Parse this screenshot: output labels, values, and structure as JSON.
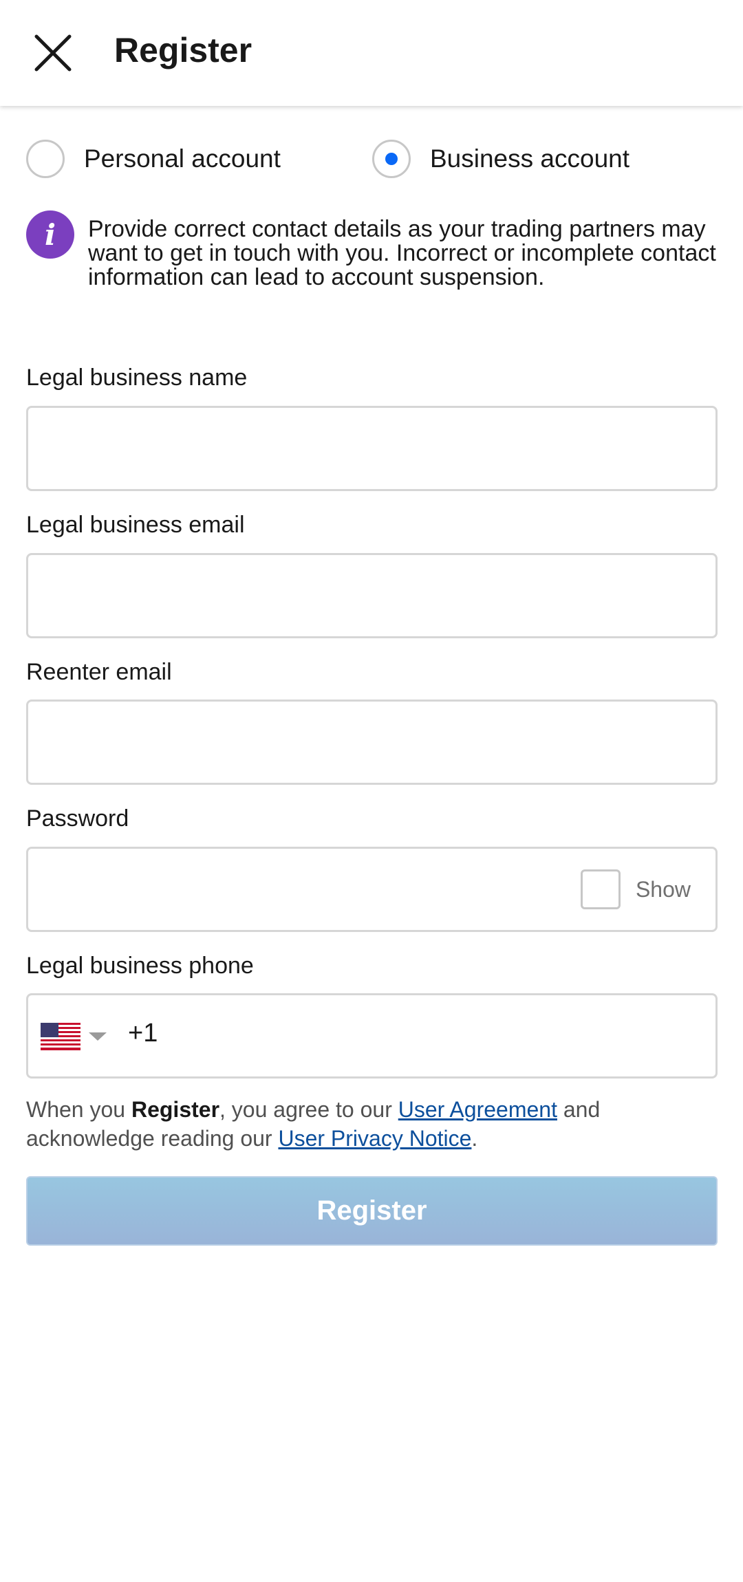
{
  "header": {
    "title": "Register",
    "close_icon": "close-icon"
  },
  "account_type": {
    "options": [
      {
        "label": "Personal account",
        "selected": false
      },
      {
        "label": "Business account",
        "selected": true
      }
    ],
    "selected_color": "#0968f6"
  },
  "notice": {
    "icon": "info-icon",
    "icon_letter": "i",
    "icon_color": "#7b3fbf",
    "text": "Provide correct contact details as your trading partners may want to get in touch with you. Incorrect or incomplete contact information can lead to account suspension."
  },
  "form": {
    "business_name": {
      "label": "Legal business name",
      "value": ""
    },
    "business_email": {
      "label": "Legal business email",
      "value": ""
    },
    "reenter_email": {
      "label": "Reenter email",
      "value": ""
    },
    "password": {
      "label": "Password",
      "value": "",
      "show_label": "Show"
    },
    "phone": {
      "label": "Legal business phone",
      "country_icon": "us-flag-icon",
      "code": "+1",
      "value": ""
    }
  },
  "legal": {
    "prefix": "When you ",
    "bold": "Register",
    "middle": ", you agree to our ",
    "link1": "User Agreement",
    "and": " and acknowledge reading our ",
    "link2": "User Privacy Notice",
    "end": "."
  },
  "register_button": {
    "label": "Register",
    "enabled": false
  }
}
